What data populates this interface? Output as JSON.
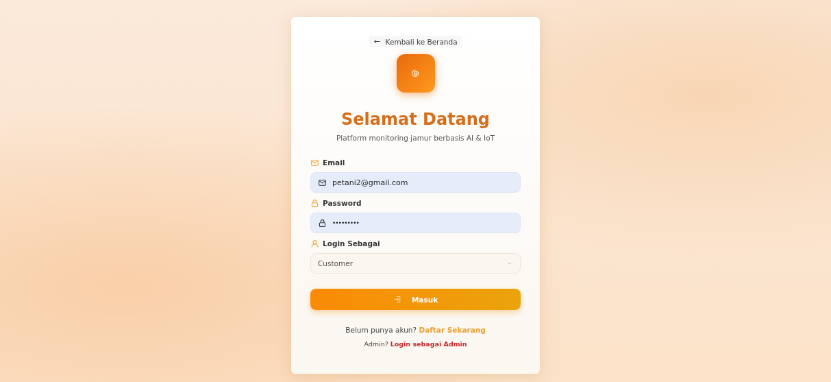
{
  "back_link": {
    "label": "Kembali ke Beranda",
    "icon": "←"
  },
  "title": "Selamat Datang",
  "subtitle": "Platform monitoring jamur berbasis AI & IoT",
  "fields": [
    {
      "kind": "email",
      "label": "Email",
      "value": "petani2@gmail.com"
    },
    {
      "kind": "password",
      "label": "Password",
      "value": "•••••••••"
    },
    {
      "kind": "select",
      "label": "Login Sebagai",
      "value": "Customer"
    }
  ],
  "submit_button": {
    "label": "Masuk"
  },
  "register_prompt": {
    "text": "Belum punya akun?",
    "link": "Daftar Sekarang"
  },
  "admin_prompt": {
    "text": "Admin?",
    "link": "Login sebagai Admin"
  }
}
